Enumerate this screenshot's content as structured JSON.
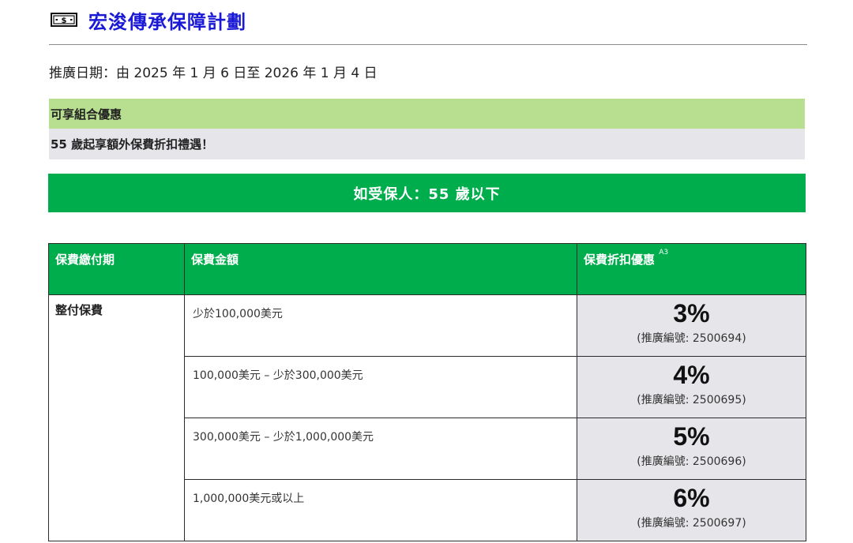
{
  "header": {
    "icon": "cash-icon",
    "title": "宏浚傳承保障計劃"
  },
  "promo_period": "推廣日期：由 2025 年 1 月 6 日至 2026 年 1 月 4 日",
  "combo_offer": {
    "heading": "可享組合優惠",
    "body": "55 歲起享額外保費折扣禮遇！"
  },
  "age_banner": "如受保人：55 歲以下",
  "colors": {
    "title_blue": "#1a1ad6",
    "green": "#00ad4d",
    "light_green": "#b8df90",
    "grey_band": "#e6e6ea"
  },
  "table": {
    "headers": {
      "term": "保費繳付期",
      "amount": "保費金額",
      "discount": "保費折扣優惠",
      "discount_note": "A3"
    },
    "term_label": "整付保費",
    "rows": [
      {
        "amount": "少於100,000美元",
        "discount": "3%",
        "code": "(推廣編號: 2500694)"
      },
      {
        "amount": "100,000美元 – 少於300,000美元",
        "discount": "4%",
        "code": "(推廣編號: 2500695)"
      },
      {
        "amount": "300,000美元 – 少於1,000,000美元",
        "discount": "5%",
        "code": "(推廣編號: 2500696)"
      },
      {
        "amount": "1,000,000美元或以上",
        "discount": "6%",
        "code": "(推廣編號: 2500697)"
      }
    ]
  }
}
